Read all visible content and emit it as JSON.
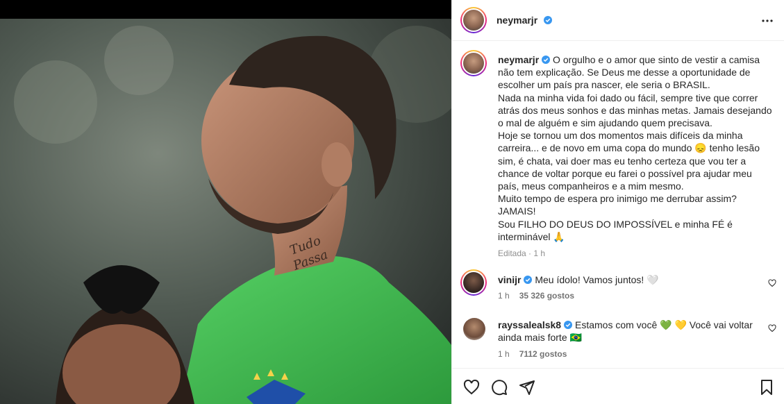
{
  "post": {
    "username": "neymarjr",
    "more_icon": "more-horizontal-icon"
  },
  "caption": {
    "username": "neymarjr",
    "lines": [
      "O orgulho e o amor que sinto de vestir a camisa",
      "não tem explicação. Se Deus me desse a oportunidade de",
      "escolher um país pra nascer, ele seria o BRASIL.",
      "Nada na minha vida foi dado ou fácil, sempre tive que correr",
      "atrás dos meus sonhos e das minhas metas. Jamais desejando",
      "o mal de alguém e sim ajudando quem precisava.",
      "Hoje se tornou um dos momentos mais difíceis da minha",
      "carreira... e de novo em uma copa do mundo 😞 tenho lesão",
      "sim, é chata, vai doer mas eu tenho certeza que vou ter a",
      "chance de voltar porque eu farei o possível pra ajudar meu",
      "país, meus companheiros e a mim mesmo.",
      "Muito tempo de espera pro inimigo me derrubar assim?",
      "JAMAIS!",
      "Sou FILHO DO DEUS DO IMPOSSÍVEL e minha FÉ é",
      "interminável 🙏"
    ],
    "edited": "Editada",
    "time": "1 h"
  },
  "comments": [
    {
      "username": "vinijr",
      "text": "Meu ídolo! Vamos juntos! 🤍",
      "time": "1 h",
      "likes": "35 326 gostos"
    },
    {
      "username": "rayssalealsk8",
      "text": "Estamos com você 💚 💛 Você vai voltar ainda mais forte 🇧🇷",
      "time": "1 h",
      "likes": "7112 gostos"
    }
  ],
  "colors": {
    "verified": "#3897f0",
    "green_jersey": "#3fb34f",
    "meta": "#8e8e8e"
  }
}
